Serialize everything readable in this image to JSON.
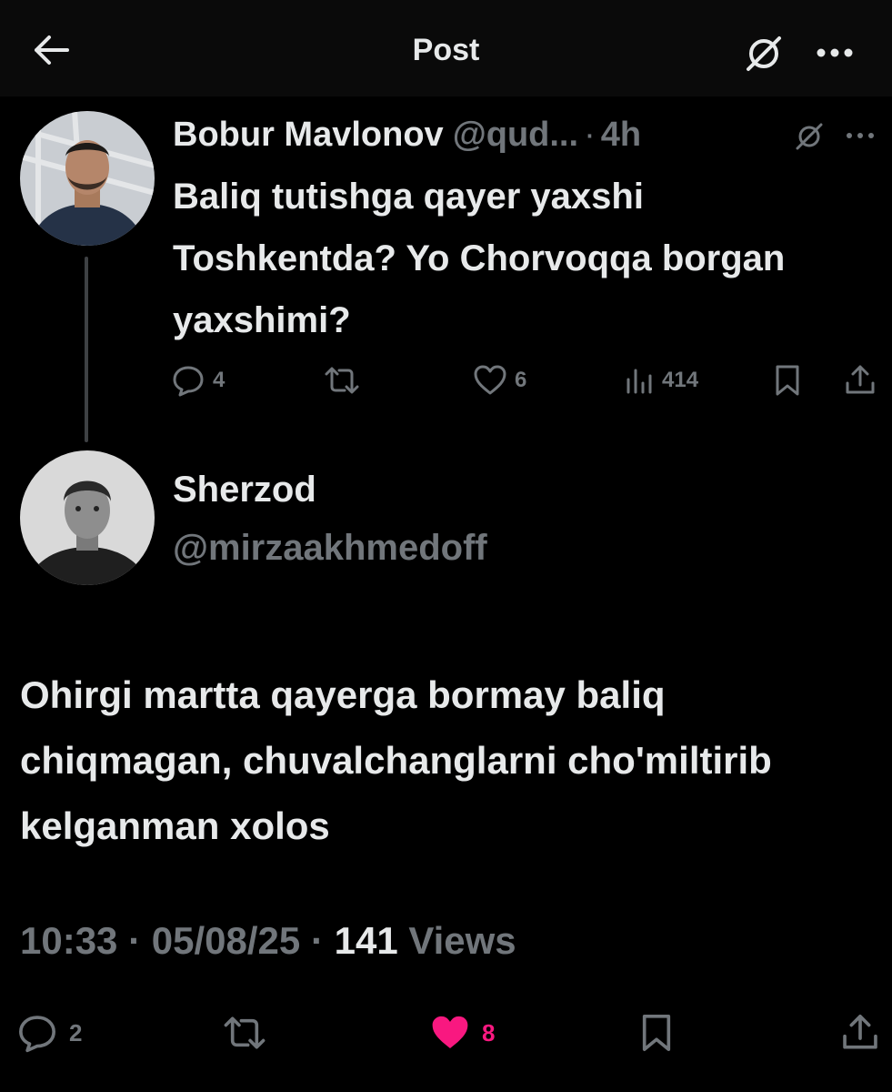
{
  "header": {
    "title": "Post"
  },
  "parent_post": {
    "name": "Bobur Mavlonov",
    "handle": "@qud...",
    "separator": "·",
    "time": "4h",
    "text": "Baliq tutishga qayer yaxshi Toshkentda? Yo Chorvoqqa borgan yaxshimi?",
    "replies": "4",
    "likes": "6",
    "views": "414"
  },
  "main_post": {
    "name": "Sherzod",
    "handle": "@mirzaakhmedoff",
    "text": "Ohirgi martta qayerga bormay baliq chiqmagan, chuvalchanglarni cho'miltirib kelganman xolos",
    "time": "10:33",
    "date": "05/08/25",
    "separator": "·",
    "views_count": "141",
    "views_label": "Views",
    "replies": "2",
    "likes": "8"
  },
  "colors": {
    "background": "#000000",
    "text_primary": "#e7e9ea",
    "text_secondary": "#71767b",
    "like_active": "#f91880"
  }
}
